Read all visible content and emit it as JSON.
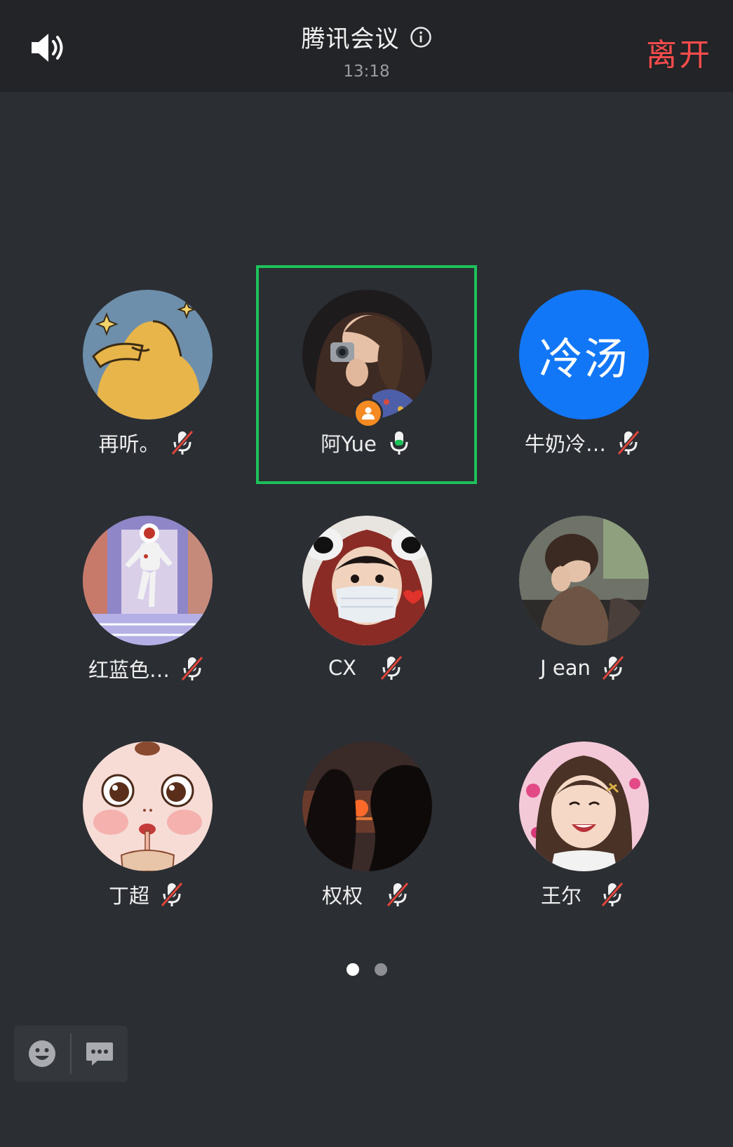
{
  "header": {
    "title": "腾讯会议",
    "time": "13:18",
    "leave_label": "离开",
    "speaker_icon": "speaker-icon",
    "info_icon": "info-icon"
  },
  "participants": [
    {
      "name": "再听。",
      "mic": "muted",
      "avatar": "cartoon-blob"
    },
    {
      "name": "阿Yue",
      "mic": "active",
      "avatar": "photo",
      "host": true,
      "speaking": true
    },
    {
      "name": "牛奶冷…",
      "mic": "muted",
      "avatar": "text",
      "avatar_text": "冷汤"
    },
    {
      "name": "红蓝色…",
      "mic": "muted",
      "avatar": "astronaut"
    },
    {
      "name": "CX",
      "mic": "muted",
      "avatar": "photo"
    },
    {
      "name": "J ean",
      "mic": "muted",
      "avatar": "photo"
    },
    {
      "name": "丁超",
      "mic": "muted",
      "avatar": "cartoon-face"
    },
    {
      "name": "权权",
      "mic": "muted",
      "avatar": "sunset-silhouette"
    },
    {
      "name": "王尔",
      "mic": "muted",
      "avatar": "photo"
    }
  ],
  "pager": {
    "pages": 2,
    "current": 1
  },
  "toolbar": {
    "emoji_icon": "emoji-icon",
    "chat_icon": "chat-icon"
  },
  "colors": {
    "background": "#2b2e33",
    "topbar": "#232427",
    "leave": "#ff4c4c",
    "speaking_frame": "#1dc15a",
    "host_badge": "#f48a21",
    "text_avatar_bg": "#1277f7",
    "muted_slash": "#e0453a"
  }
}
